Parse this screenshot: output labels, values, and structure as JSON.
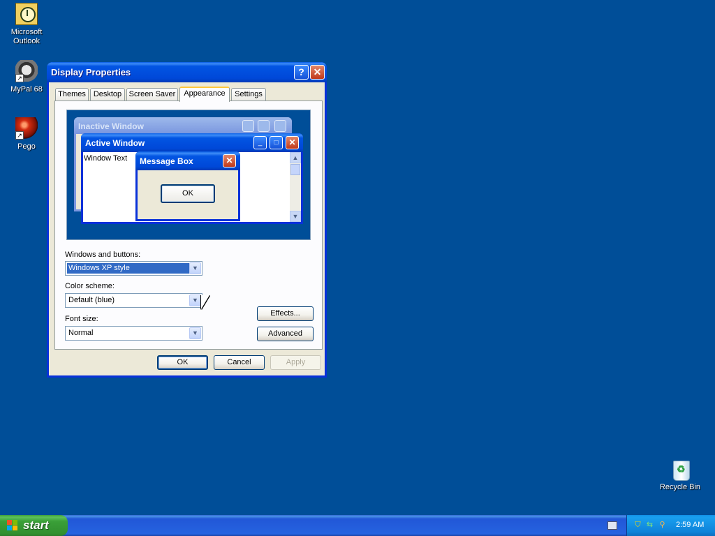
{
  "desktop": {
    "icons": [
      {
        "label_line1": "Microsoft",
        "label_line2": "Outlook"
      },
      {
        "label_line1": "MyPal 68",
        "label_line2": ""
      },
      {
        "label_line1": "Pego",
        "label_line2": ""
      },
      {
        "label_line1": "Recycle Bin",
        "label_line2": ""
      }
    ]
  },
  "dialog": {
    "title": "Display Properties",
    "help_glyph": "?",
    "close_glyph": "✕",
    "tabs": [
      "Themes",
      "Desktop",
      "Screen Saver",
      "Appearance",
      "Settings"
    ],
    "active_tab": "Appearance",
    "preview": {
      "inactive_title": "Inactive Window",
      "active_title": "Active Window",
      "window_text": "Window Text",
      "message_box_title": "Message Box",
      "message_box_ok": "OK"
    },
    "windows_and_buttons": {
      "label": "Windows and buttons:",
      "value": "Windows XP style"
    },
    "color_scheme": {
      "label": "Color scheme:",
      "value": "Default (blue)"
    },
    "font_size": {
      "label": "Font size:",
      "value": "Normal"
    },
    "effects_button": "Effects...",
    "advanced_button": "Advanced",
    "ok_button": "OK",
    "cancel_button": "Cancel",
    "apply_button": "Apply"
  },
  "taskbar": {
    "start_label": "start",
    "clock": "2:59 AM"
  },
  "colors": {
    "desktop_bg": "#004e98",
    "title_bar": "#0255e3",
    "taskbar": "#2663e0",
    "start_green": "#3a9f38",
    "tray": "#0f83d9"
  }
}
